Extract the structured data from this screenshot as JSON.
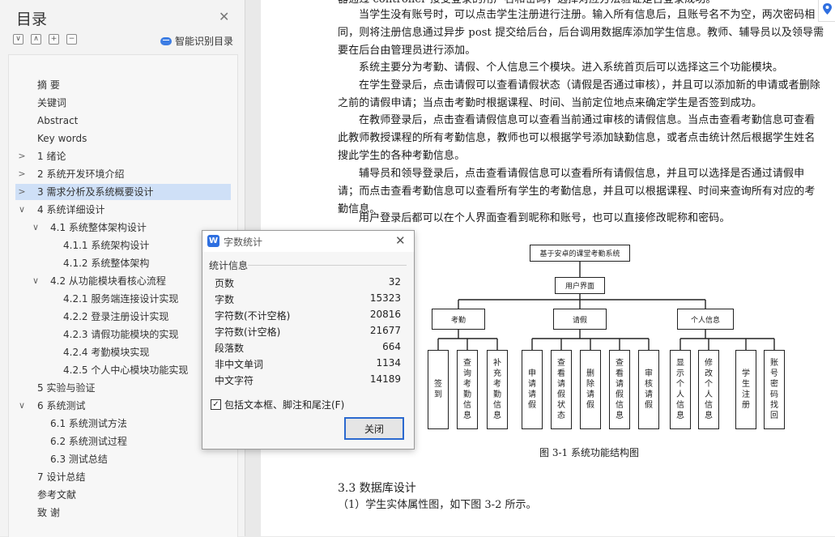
{
  "toc": {
    "title": "目录",
    "smart_label": "智能识别目录",
    "tools": [
      "∨",
      "∧",
      "+",
      "−"
    ],
    "items": [
      {
        "label": "摘  要",
        "level": 0,
        "arrow": ""
      },
      {
        "label": "关键词",
        "level": 0,
        "arrow": ""
      },
      {
        "label": "Abstract",
        "level": 0,
        "arrow": ""
      },
      {
        "label": "Key words",
        "level": 0,
        "arrow": ""
      },
      {
        "label": "1  绪论",
        "level": 0,
        "arrow": ">"
      },
      {
        "label": "2  系统开发环境介绍",
        "level": 0,
        "arrow": ">"
      },
      {
        "label": "3  需求分析及系统概要设计",
        "level": 0,
        "arrow": ">",
        "selected": true
      },
      {
        "label": "4  系统详细设计",
        "level": 0,
        "arrow": "∨"
      },
      {
        "label": "4.1  系统整体架构设计",
        "level": 1,
        "arrow": "∨"
      },
      {
        "label": "4.1.1  系统架构设计",
        "level": 2,
        "arrow": ""
      },
      {
        "label": "4.1.2  系统整体架构",
        "level": 2,
        "arrow": ""
      },
      {
        "label": "4.2  从功能模块看核心流程",
        "level": 1,
        "arrow": "∨"
      },
      {
        "label": "4.2.1  服务端连接设计实现",
        "level": 2,
        "arrow": ""
      },
      {
        "label": "4.2.2  登录注册设计实现",
        "level": 2,
        "arrow": ""
      },
      {
        "label": "4.2.3  请假功能模块的实现",
        "level": 2,
        "arrow": ""
      },
      {
        "label": "4.2.4  考勤模块实现",
        "level": 2,
        "arrow": ""
      },
      {
        "label": "4.2.5  个人中心模块功能实现",
        "level": 2,
        "arrow": ""
      },
      {
        "label": "5  实验与验证",
        "level": 0,
        "arrow": ""
      },
      {
        "label": "6  系统测试",
        "level": 0,
        "arrow": "∨"
      },
      {
        "label": "6.1  系统测试方法",
        "level": 1,
        "arrow": ""
      },
      {
        "label": "6.2  系统测试过程",
        "level": 1,
        "arrow": ""
      },
      {
        "label": "6.3  测试总结",
        "level": 1,
        "arrow": ""
      },
      {
        "label": "7  设计总结",
        "level": 0,
        "arrow": ""
      },
      {
        "label": "参考文献",
        "level": 0,
        "arrow": ""
      },
      {
        "label": "致  谢",
        "level": 0,
        "arrow": ""
      }
    ]
  },
  "document": {
    "paragraphs": [
      {
        "text": "器通过 controller 接受登录的用户名和密码，选择对应方法验证是否登录成功。",
        "indent": false
      },
      {
        "text": "当学生没有账号时，可以点击学生注册进行注册。输入所有信息后，且账号名不为空，两次密码相同，则将注册信息通过异步 post 提交给后台，后台调用数据库添加学生信息。教师、辅导员以及领导需要在后台由管理员进行添加。",
        "indent": true
      },
      {
        "text": "系统主要分为考勤、请假、个人信息三个模块。进入系统首页后可以选择这三个功能模块。",
        "indent": true
      },
      {
        "text": "在学生登录后，点击请假可以查看请假状态（请假是否通过审核），并且可以添加新的申请或者删除之前的请假申请；当点击考勤时根据课程、时间、当前定位地点来确定学生是否签到成功。",
        "indent": true
      },
      {
        "text": "在教师登录后，点击查看请假信息可以查看当前通过审核的请假信息。当点击查看考勤信息可查看此教师教授课程的所有考勤信息，教师也可以根据学号添加缺勤信息，或者点击统计然后根据学生姓名搜此学生的各种考勤信息。",
        "indent": true
      },
      {
        "text": "辅导员和领导登录后，点击查看请假信息可以查看所有请假信息，并且可以选择是否通过请假申请；而点击查看考勤信息可以查看所有学生的考勤信息，并且可以根据课程、时间来查询所有对应的考勤信息。",
        "indent": true
      },
      {
        "text": "用户登录后都可以在个人界面查看到昵称和账号，也可以直接修改昵称和密码。",
        "indent": true
      }
    ],
    "diagram": {
      "root": "基于安卓的课堂考勤系统",
      "ui": "用户界面",
      "modules": [
        {
          "name": "考勤",
          "children": [
            "签到",
            "查询考勤信息",
            "补充考勤信息"
          ]
        },
        {
          "name": "请假",
          "children": [
            "申请请假",
            "查看请假状态",
            "删除请假",
            "查看请假信息",
            "审核请假"
          ]
        },
        {
          "name": "个人信息",
          "children": [
            "显示个人信息",
            "修改个人信息",
            "学生注册",
            "账号密码找回"
          ]
        }
      ]
    },
    "figure_caption": "图 3-1    系统功能结构图",
    "section_heading": "3.3  数据库设计",
    "after_heading": "（1）学生实体属性图，如下图 3-2 所示。"
  },
  "dialog": {
    "title": "字数统计",
    "section": "统计信息",
    "stats": [
      {
        "label": "页数",
        "value": "32"
      },
      {
        "label": "字数",
        "value": "15323"
      },
      {
        "label": "字符数(不计空格)",
        "value": "20816"
      },
      {
        "label": "字符数(计空格)",
        "value": "21677"
      },
      {
        "label": "段落数",
        "value": "664"
      },
      {
        "label": "非中文单词",
        "value": "1134"
      },
      {
        "label": "中文字符",
        "value": "14189"
      }
    ],
    "checkbox_label": "包括文本框、脚注和尾注(F)",
    "checkbox_checked": true,
    "close_button": "关闭"
  },
  "colors": {
    "accent": "#2b69cf",
    "selection": "#cfe0f7",
    "logo": "#2e6fe0"
  }
}
